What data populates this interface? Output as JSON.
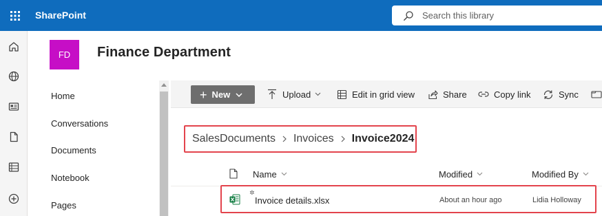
{
  "suite": {
    "brand": "SharePoint",
    "search_placeholder": "Search this library"
  },
  "site": {
    "logo_initials": "FD",
    "title": "Finance Department",
    "logo_color": "#c60ec6"
  },
  "left_nav": {
    "items": [
      "Home",
      "Conversations",
      "Documents",
      "Notebook",
      "Pages"
    ]
  },
  "command_bar": {
    "new_label": "New",
    "upload_label": "Upload",
    "grid_label": "Edit in grid view",
    "share_label": "Share",
    "copy_link_label": "Copy link",
    "sync_label": "Sync"
  },
  "breadcrumb": {
    "items": [
      "SalesDocuments",
      "Invoices"
    ],
    "current": "Invoice2024"
  },
  "table": {
    "columns": {
      "name": "Name",
      "modified": "Modified",
      "modified_by": "Modified By"
    },
    "rows": [
      {
        "name": "Invoice details.xlsx",
        "modified": "About an hour ago",
        "modified_by": "Lidia Holloway"
      }
    ]
  },
  "colors": {
    "suite_bar": "#0f6cbd",
    "highlight_border": "#e3434c",
    "new_button": "#6e6e6e",
    "excel_green": "#107c41"
  }
}
